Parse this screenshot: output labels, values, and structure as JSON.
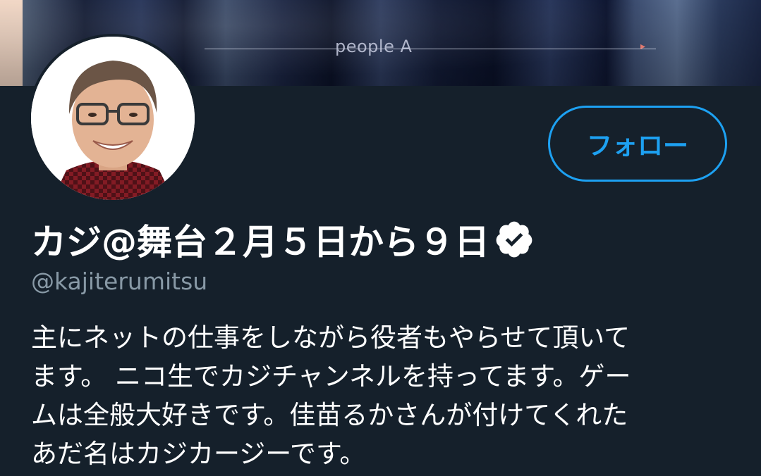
{
  "banner": {
    "caption": "people A"
  },
  "profile": {
    "follow_label": "フォロー",
    "display_name": "カジ@舞台２月５日から９日",
    "handle": "@kajiterumitsu",
    "verified": true,
    "bio_lines": [
      "主にネットの仕事をしながら役者もやらせて頂いて",
      "ます。 ニコ生でカジチャンネルを持ってます。ゲー",
      "ムは全般大好きです。佳苗るかさんが付けてくれた",
      "あだ名はカジカージーです。"
    ]
  },
  "colors": {
    "background": "#15202b",
    "accent": "#1da1f2",
    "secondary_text": "#8899a6"
  },
  "icons": {
    "verified": "verified-badge-icon"
  }
}
